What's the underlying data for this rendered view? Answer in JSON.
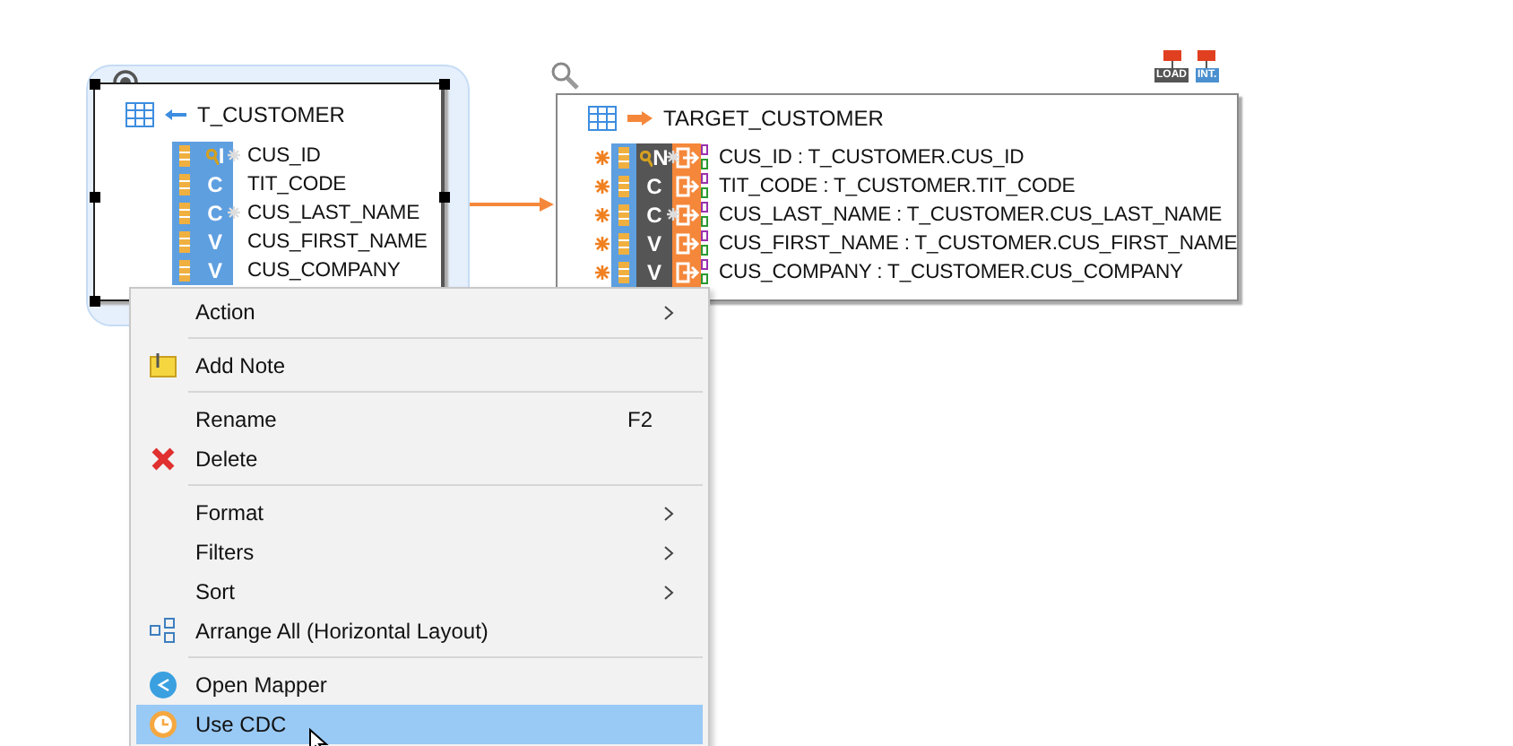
{
  "source_table": {
    "title": "T_CUSTOMER",
    "selected": true,
    "columns": [
      {
        "name": "CUS_ID",
        "type": "I",
        "key": true,
        "starred": true
      },
      {
        "name": "TIT_CODE",
        "type": "C",
        "key": false,
        "starred": false
      },
      {
        "name": "CUS_LAST_NAME",
        "type": "C",
        "key": false,
        "starred": true
      },
      {
        "name": "CUS_FIRST_NAME",
        "type": "V",
        "key": false,
        "starred": false
      },
      {
        "name": "CUS_COMPANY",
        "type": "V",
        "key": false,
        "starred": false
      }
    ]
  },
  "target_table": {
    "title": "TARGET_CUSTOMER",
    "badges": [
      "LOAD",
      "INT."
    ],
    "columns": [
      {
        "name": "CUS_ID : T_CUSTOMER.CUS_ID",
        "type": "N",
        "key": true,
        "starred": true
      },
      {
        "name": "TIT_CODE : T_CUSTOMER.TIT_CODE",
        "type": "C",
        "key": false,
        "starred": false
      },
      {
        "name": "CUS_LAST_NAME : T_CUSTOMER.CUS_LAST_NAME",
        "type": "C",
        "key": false,
        "starred": true
      },
      {
        "name": "CUS_FIRST_NAME : T_CUSTOMER.CUS_FIRST_NAME",
        "type": "V",
        "key": false,
        "starred": false
      },
      {
        "name": "CUS_COMPANY : T_CUSTOMER.CUS_COMPANY",
        "type": "V",
        "key": false,
        "starred": false
      }
    ]
  },
  "context_menu": {
    "groups": [
      [
        {
          "label": "Action",
          "submenu": true,
          "selected": false
        }
      ],
      [
        {
          "label": "Add Note",
          "submenu": false,
          "selected": false
        }
      ],
      [
        {
          "label": "Rename",
          "shortcut": "F2",
          "submenu": false,
          "selected": false
        },
        {
          "label": "Delete",
          "submenu": false,
          "selected": false
        }
      ],
      [
        {
          "label": "Format",
          "submenu": true,
          "selected": false
        },
        {
          "label": "Filters",
          "submenu": true,
          "selected": false
        },
        {
          "label": "Sort",
          "submenu": true,
          "selected": false
        },
        {
          "label": "Arrange All (Horizontal Layout)",
          "submenu": false,
          "selected": false
        }
      ],
      [
        {
          "label": "Open Mapper",
          "submenu": false,
          "selected": false
        },
        {
          "label": "Use CDC",
          "submenu": false,
          "selected": true
        }
      ]
    ]
  }
}
